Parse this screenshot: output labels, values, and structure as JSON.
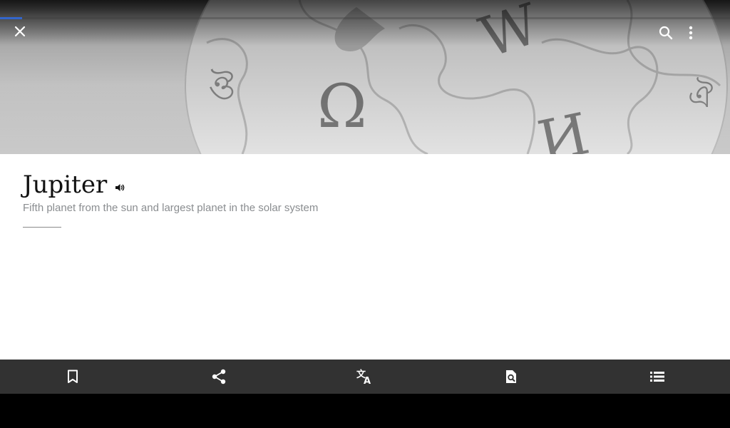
{
  "progress": {
    "percent": 3,
    "color": "#3366cc"
  },
  "toolbar": {
    "close_icon": "close-icon",
    "search_icon": "search-icon",
    "menu_icon": "more-vertical-icon"
  },
  "lead_image": {
    "description_icon": "wikipedia-puzzle-globe-image"
  },
  "article": {
    "title": "Jupiter",
    "description": "Fifth planet from the sun and largest planet in the solar system",
    "audio_icon": "volume-icon"
  },
  "action_bar": {
    "background": "#323232",
    "items": [
      {
        "icon": "bookmark-icon"
      },
      {
        "icon": "share-icon"
      },
      {
        "icon": "translate-icon"
      },
      {
        "icon": "find-in-page-icon"
      },
      {
        "icon": "table-of-contents-icon"
      }
    ]
  }
}
